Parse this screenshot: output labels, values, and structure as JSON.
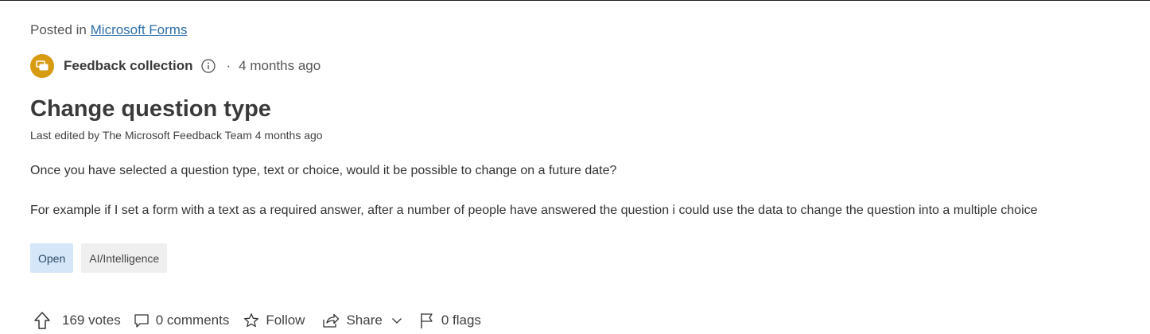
{
  "posted_in": {
    "prefix": "Posted in",
    "link": "Microsoft Forms"
  },
  "meta": {
    "category": "Feedback collection",
    "separator": "·",
    "time_ago": "4 months ago",
    "badge_color": "#d79b11"
  },
  "post": {
    "title": "Change question type",
    "edited": "Last edited by The Microsoft Feedback Team 4 months ago",
    "paragraphs": [
      "Once you have selected a question type, text or choice, would it be possible to change on a future date?",
      "For example if I set a form with a text as a required answer, after a number of people have answered the question i could use the data to change the question into a multiple choice"
    ]
  },
  "tags": [
    {
      "label": "Open",
      "color": "#d4e6f8"
    },
    {
      "label": "AI/Intelligence",
      "color": "#efefef"
    }
  ],
  "actions": {
    "votes": "169 votes",
    "comments": "0 comments",
    "follow": "Follow",
    "share": "Share",
    "flags": "0 flags"
  },
  "icons": {
    "badge": "chat-bubbles-icon",
    "info": "info-icon",
    "vote": "upvote-arrow-icon",
    "comment": "comment-icon",
    "follow": "star-icon",
    "share": "share-icon",
    "share_menu": "chevron-down-icon",
    "flag": "flag-icon"
  }
}
